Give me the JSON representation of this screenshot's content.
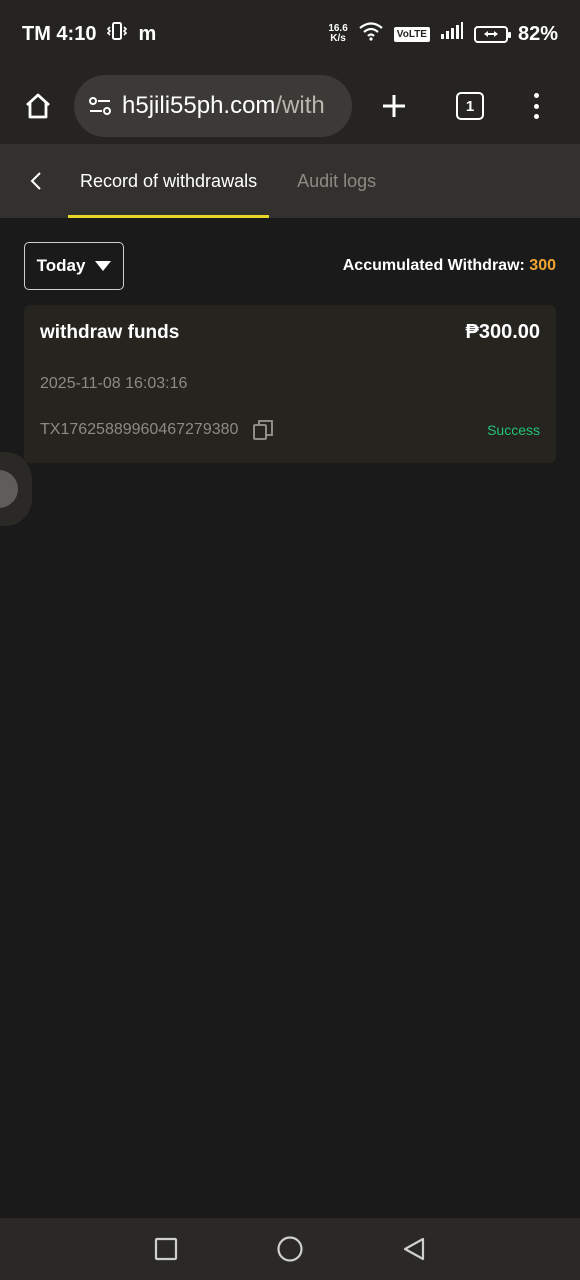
{
  "status_bar": {
    "carrier_time": "TM 4:10",
    "app_glyph": "m",
    "net_speed_value": "16.6",
    "net_speed_unit": "K/s",
    "volte": "VoLTE",
    "battery": "82%"
  },
  "browser": {
    "url_main": "h5jili55ph.com",
    "url_path": "/with",
    "tab_count": "1"
  },
  "tabs": {
    "active": "Record of withdrawals",
    "inactive": "Audit logs"
  },
  "filter": {
    "date_range": "Today",
    "accumulated_label": "Accumulated Withdraw:",
    "accumulated_value": "300"
  },
  "record": {
    "type": "withdraw funds",
    "amount": "₱300.00",
    "time": "2025-11-08 16:03:16",
    "id": "TX17625889960467279380",
    "status": "Success"
  },
  "colors": {
    "accent_tab": "#e6d628",
    "accumulated_value": "#f0a531",
    "status_success": "#23c47a"
  }
}
